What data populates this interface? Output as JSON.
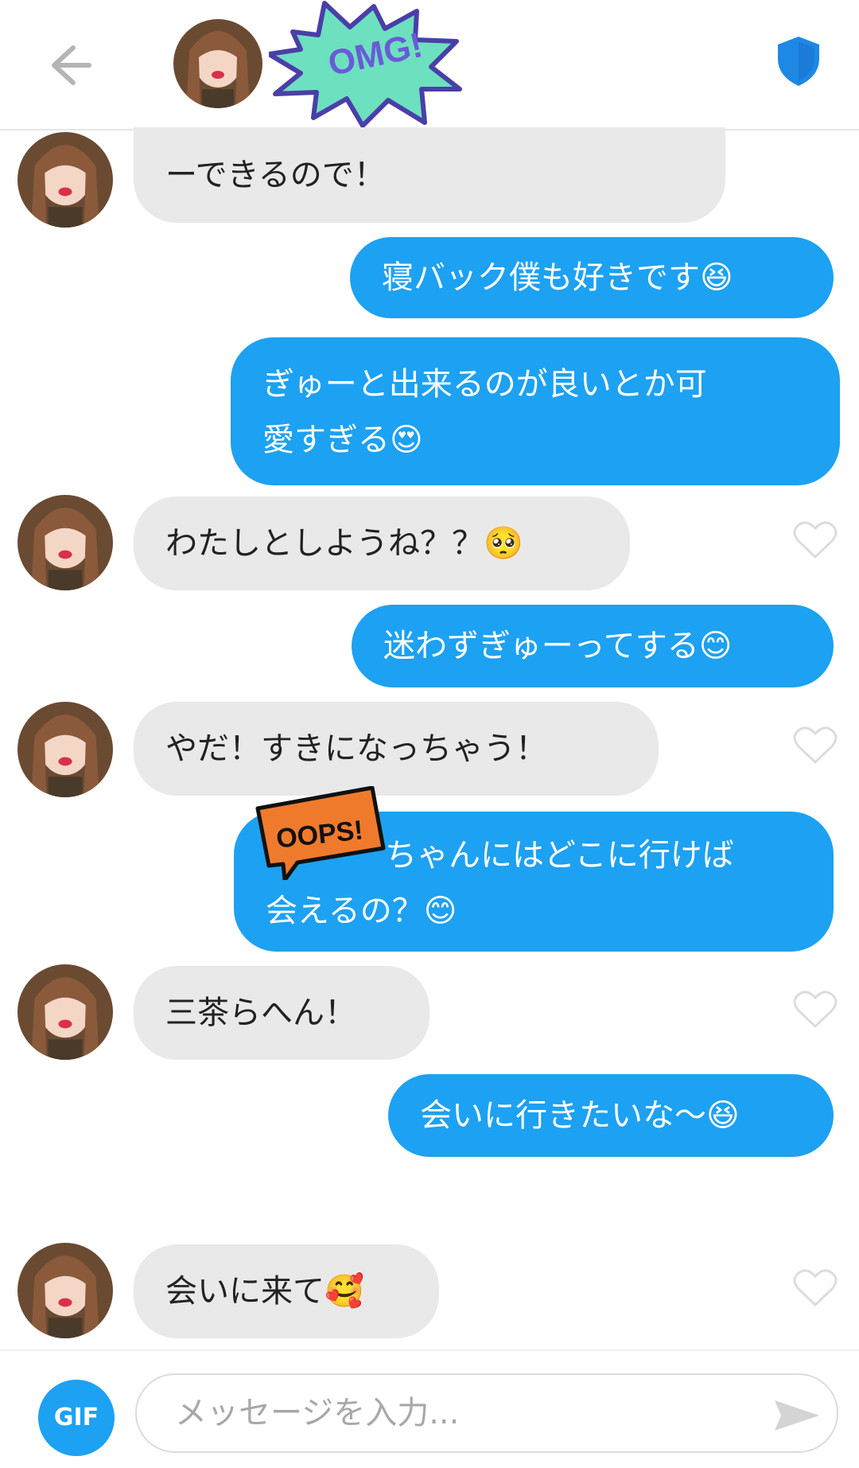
{
  "header": {
    "back_icon": "arrow-left-icon",
    "sticker_text": "OMG!",
    "shield_icon": "shield-icon",
    "accent": "#1da1f2"
  },
  "messages": [
    {
      "side": "in",
      "text": "ーできるので！"
    },
    {
      "side": "out",
      "text": "寝バック僕も好きです😆"
    },
    {
      "side": "out",
      "line1": "ぎゅーと出来るのが良いとか可",
      "line2": "愛すぎる😍"
    },
    {
      "side": "in",
      "text": "わたしとしようね？？🥺"
    },
    {
      "side": "out",
      "text": "迷わずぎゅーってする😊"
    },
    {
      "side": "in",
      "text": "やだ！すきになっちゃう！"
    },
    {
      "side": "out",
      "line1": "ちゃんにはどこに行けば",
      "line2": "会えるの？😊"
    },
    {
      "side": "in",
      "text": "三茶らへん！"
    },
    {
      "side": "out",
      "text": "会いに行きたいな〜😆"
    },
    {
      "side": "in",
      "text": "会いに来て🥰"
    }
  ],
  "oops_text": "OOPS!",
  "composer": {
    "gif_label": "GIF",
    "placeholder": "メッセージを入力..."
  }
}
